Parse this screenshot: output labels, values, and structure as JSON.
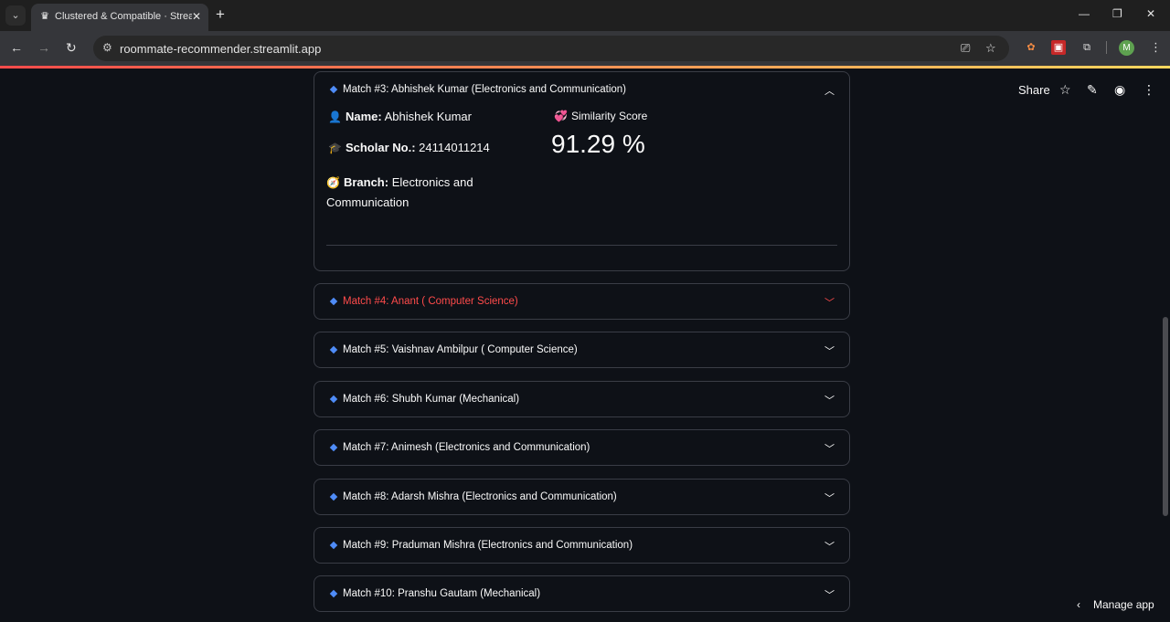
{
  "browser": {
    "tab_title": "Clustered & Compatible · Streamlit",
    "url": "roommate-recommender.streamlit.app",
    "profile_initial": "M"
  },
  "header": {
    "share_label": "Share"
  },
  "open_match": {
    "label": "Match #3: Abhishek Kumar (Electronics and Communication)",
    "name_label": "Name:",
    "name_value": "Abhishek Kumar",
    "scholar_label": "Scholar No.:",
    "scholar_value": "24114011214",
    "branch_label": "Branch:",
    "branch_value": "Electronics and Communication",
    "score_label": "Similarity Score",
    "score_value": "91.29 %"
  },
  "matches": [
    {
      "label": "Match #4: Anant ( Computer Science)",
      "hovered": true
    },
    {
      "label": "Match #5: Vaishnav Ambilpur ( Computer Science)",
      "hovered": false
    },
    {
      "label": "Match #6: Shubh Kumar (Mechanical)",
      "hovered": false
    },
    {
      "label": "Match #7: Animesh (Electronics and Communication)",
      "hovered": false
    },
    {
      "label": "Match #8: Adarsh Mishra (Electronics and Communication)",
      "hovered": false
    },
    {
      "label": "Match #9: Praduman Mishra (Electronics and Communication)",
      "hovered": false
    },
    {
      "label": "Match #10: Pranshu Gautam (Mechanical)",
      "hovered": false
    }
  ],
  "footer": {
    "manage_app_label": "Manage app"
  },
  "colors": {
    "accent": "#ff4b4b",
    "bullet": "#4f8cf7",
    "background": "#0e1117"
  }
}
